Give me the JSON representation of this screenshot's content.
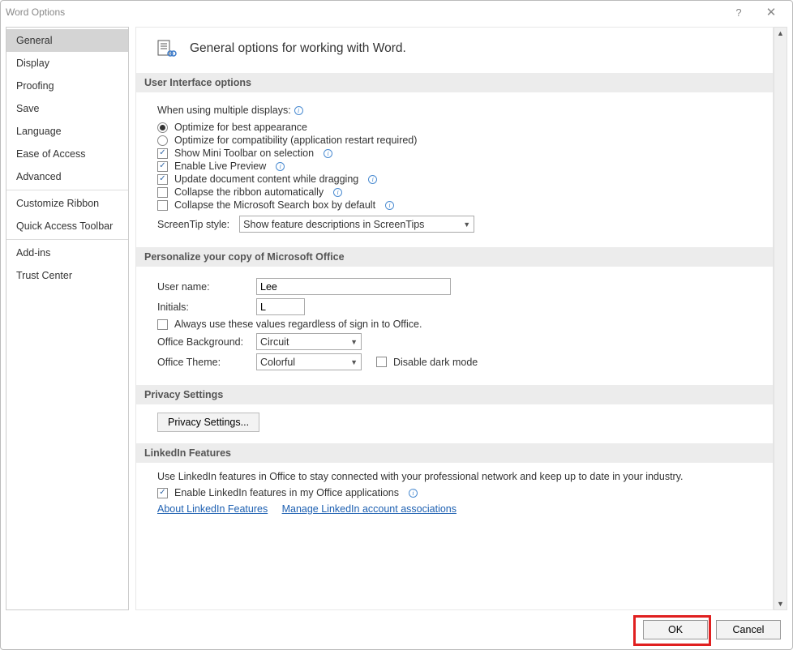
{
  "title": "Word Options",
  "sidebar": {
    "items": [
      {
        "label": "General",
        "selected": true
      },
      {
        "label": "Display"
      },
      {
        "label": "Proofing"
      },
      {
        "label": "Save"
      },
      {
        "label": "Language"
      },
      {
        "label": "Ease of Access"
      },
      {
        "label": "Advanced"
      },
      {
        "sep": true
      },
      {
        "label": "Customize Ribbon"
      },
      {
        "label": "Quick Access Toolbar"
      },
      {
        "sep": true
      },
      {
        "label": "Add-ins"
      },
      {
        "label": "Trust Center"
      }
    ]
  },
  "page": {
    "heading": "General options for working with Word."
  },
  "ui_options": {
    "header": "User Interface options",
    "multi_displays_label": "When using multiple displays:",
    "opt_appearance": "Optimize for best appearance",
    "opt_compatibility": "Optimize for compatibility (application restart required)",
    "mini_toolbar": "Show Mini Toolbar on selection",
    "live_preview": "Enable Live Preview",
    "update_dragging": "Update document content while dragging",
    "collapse_ribbon": "Collapse the ribbon automatically",
    "collapse_search": "Collapse the Microsoft Search box by default",
    "screentip_label": "ScreenTip style:",
    "screentip_value": "Show feature descriptions in ScreenTips"
  },
  "personalize": {
    "header": "Personalize your copy of Microsoft Office",
    "username_label": "User name:",
    "username_value": "Lee",
    "initials_label": "Initials:",
    "initials_value": "L",
    "always_use": "Always use these values regardless of sign in to Office.",
    "bg_label": "Office Background:",
    "bg_value": "Circuit",
    "theme_label": "Office Theme:",
    "theme_value": "Colorful",
    "disable_dark": "Disable dark mode"
  },
  "privacy": {
    "header": "Privacy Settings",
    "button": "Privacy Settings..."
  },
  "linkedin": {
    "header": "LinkedIn Features",
    "desc": "Use LinkedIn features in Office to stay connected with your professional network and keep up to date in your industry.",
    "enable": "Enable LinkedIn features in my Office applications",
    "about_link": "About LinkedIn Features",
    "manage_link": "Manage LinkedIn account associations"
  },
  "footer": {
    "ok": "OK",
    "cancel": "Cancel"
  }
}
